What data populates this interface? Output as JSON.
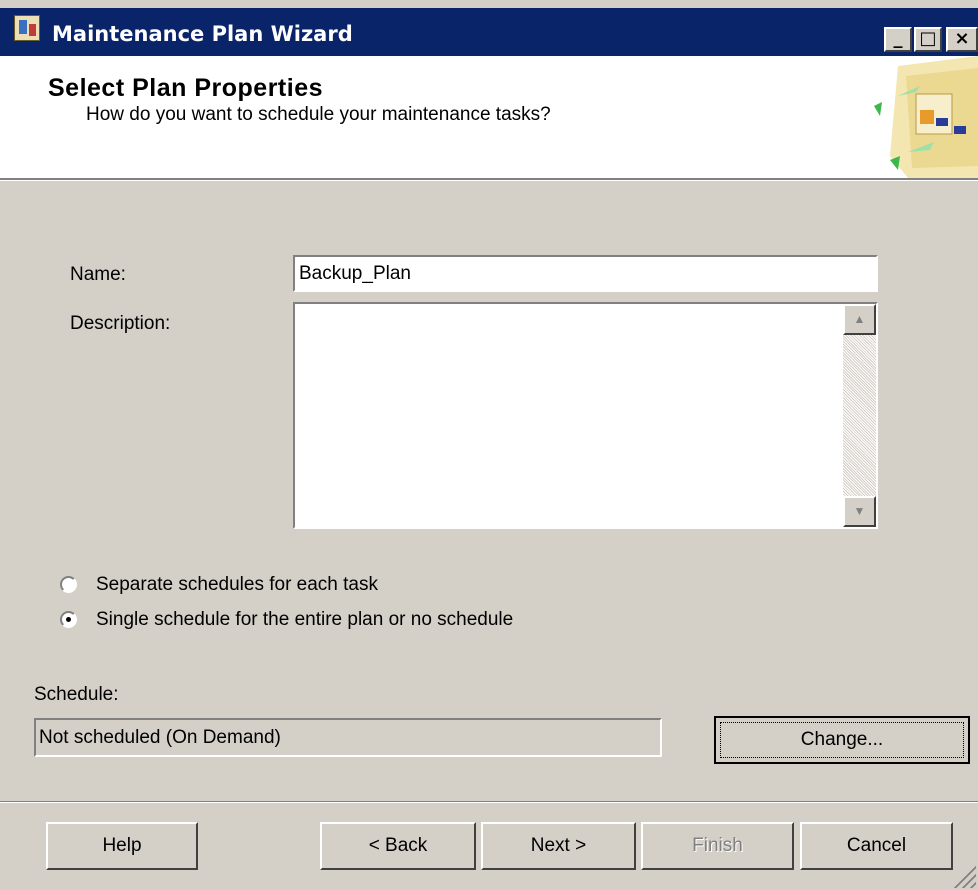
{
  "window": {
    "title": "Maintenance Plan Wizard",
    "controls": {
      "minimize": "_",
      "maximize": "□",
      "close": "×"
    }
  },
  "header": {
    "title": "Select Plan Properties",
    "subtitle": "How do you want to schedule your maintenance tasks?",
    "graphic_icon": "wizard-graphic-icon"
  },
  "form": {
    "name_label": "Name:",
    "name_value": "Backup_Plan",
    "description_label": "Description:",
    "description_value": ""
  },
  "schedule_options": [
    {
      "label": "Separate schedules for each task",
      "selected": false
    },
    {
      "label": "Single schedule for the entire plan or no schedule",
      "selected": true
    }
  ],
  "schedule": {
    "label": "Schedule:",
    "value": "Not scheduled (On Demand)",
    "change_label": "Change..."
  },
  "footer": {
    "help_label": "Help",
    "back_label": "< Back",
    "next_label": "Next >",
    "finish_label": "Finish",
    "cancel_label": "Cancel"
  },
  "colors": {
    "titlebar": "#0a246a",
    "dialog_bg": "#d4d0c8",
    "header_bg": "#ffffff"
  }
}
